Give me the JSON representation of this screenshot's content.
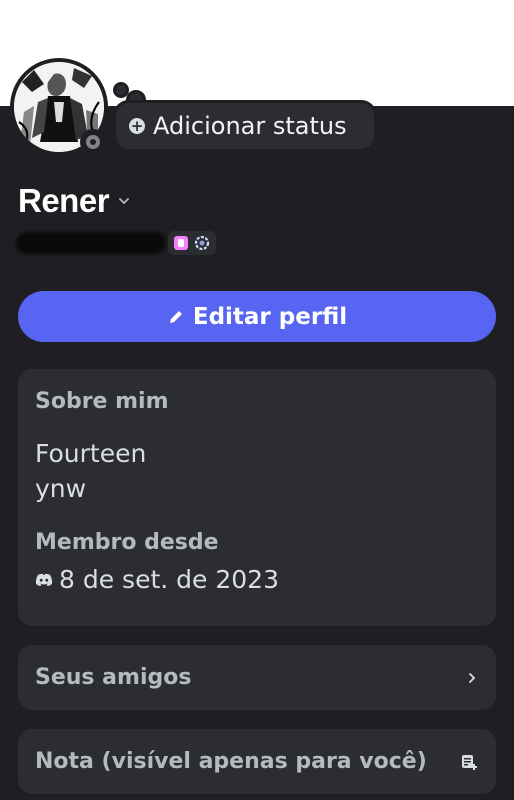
{
  "status": {
    "add_label": "Adicionar status"
  },
  "profile": {
    "username": "Rener",
    "edit_button": "Editar perfil"
  },
  "about": {
    "title": "Sobre mim",
    "bio": "Fourteen\nynw",
    "member_since_title": "Membro desde",
    "member_since_date": "8 de set. de 2023"
  },
  "friends": {
    "label": "Seus amigos"
  },
  "note": {
    "label": "Nota (visível apenas para você)"
  },
  "colors": {
    "accent": "#5865f2",
    "background": "#1f1f23",
    "card": "#2b2d31",
    "nitro_badge": "#f47fff"
  },
  "icons": {
    "status_add": "plus-circle-icon",
    "edit": "pencil-icon",
    "discord": "discord-logo-icon",
    "chevron": "chevron-right-icon",
    "note": "note-add-icon"
  }
}
